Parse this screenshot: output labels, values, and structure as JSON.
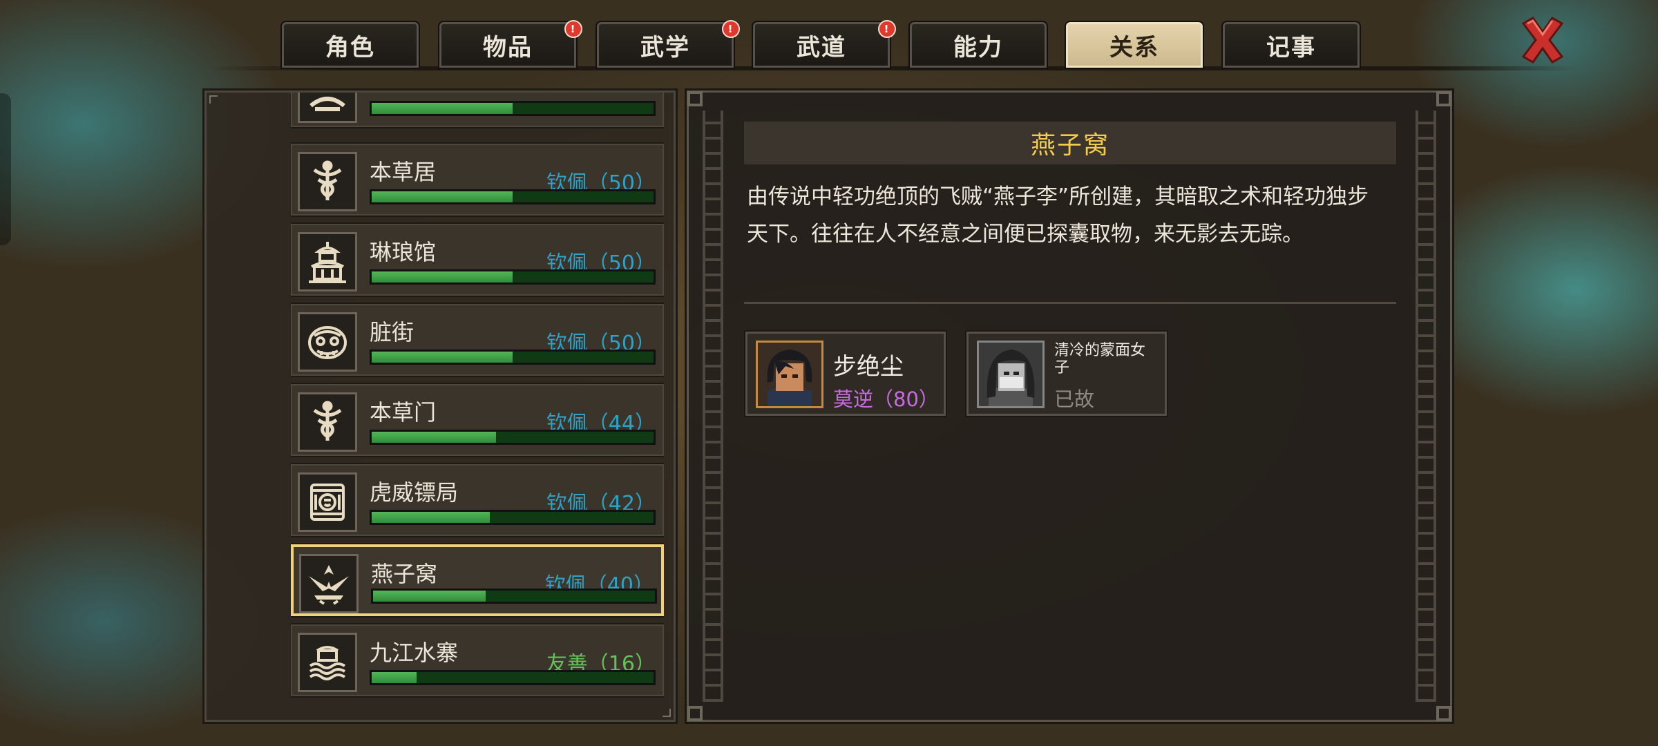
{
  "tabs": [
    {
      "label": "角色",
      "badge": false,
      "active": false
    },
    {
      "label": "物品",
      "badge": true,
      "active": false
    },
    {
      "label": "武学",
      "badge": true,
      "active": false
    },
    {
      "label": "武道",
      "badge": true,
      "active": false
    },
    {
      "label": "能力",
      "badge": false,
      "active": false
    },
    {
      "label": "关系",
      "badge": false,
      "active": true
    },
    {
      "label": "记事",
      "badge": false,
      "active": false
    }
  ],
  "badge_glyph": "!",
  "factions": [
    {
      "name": "",
      "status": "",
      "progress": 0.5,
      "icon": "faction-emblem-partial"
    },
    {
      "name": "本草居",
      "status": "钦佩（50）",
      "progress": 0.5,
      "icon": "caduceus-emblem"
    },
    {
      "name": "琳琅馆",
      "status": "钦佩（50）",
      "progress": 0.5,
      "icon": "pavilion-emblem"
    },
    {
      "name": "脏街",
      "status": "钦佩（50）",
      "progress": 0.5,
      "icon": "beast-face-emblem"
    },
    {
      "name": "本草门",
      "status": "钦佩（44）",
      "progress": 0.44,
      "icon": "caduceus-emblem"
    },
    {
      "name": "虎威镖局",
      "status": "钦佩（42）",
      "progress": 0.42,
      "icon": "tiger-shield-emblem"
    },
    {
      "name": "燕子窝",
      "status": "钦佩（40）",
      "progress": 0.4,
      "icon": "swallow-emblem"
    },
    {
      "name": "九江水寨",
      "status": "友善（16）",
      "progress": 0.16,
      "icon": "water-fort-emblem"
    }
  ],
  "selected_index": 6,
  "colors": {
    "admire": "#2fa1c4",
    "friendly": "#63c25a",
    "title": "#f3cc4e",
    "member_rel": "#c86be0",
    "dead": "#8f8a82"
  },
  "detail": {
    "title": "燕子窝",
    "description": "由传说中轻功绝顶的飞贼“燕子李”所创建，其暗取之术和轻功独步天下。往往在人不经意之间便已探囊取物，来无影去无踪。",
    "members": [
      {
        "name": "步绝尘",
        "status": "莫逆（80）",
        "dead": false
      },
      {
        "name": "清冷的蒙面女子",
        "status": "已故",
        "dead": true
      }
    ]
  }
}
